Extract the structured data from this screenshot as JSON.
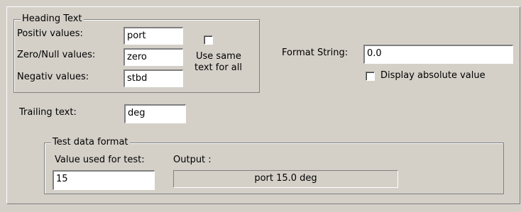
{
  "heading_group": {
    "legend": "Heading Text",
    "positive_label": "Positiv values:",
    "positive_value": "port",
    "zero_label": "Zero/Null values:",
    "zero_value": "zero",
    "negative_label": "Negativ values:",
    "negative_value": "stbd",
    "same_text_checked": false,
    "same_text_label_line1": "Use same",
    "same_text_label_line2": "text for all"
  },
  "format": {
    "label": "Format String:",
    "value": "0.0",
    "absolute_checked": false,
    "absolute_label": "Display absolute value"
  },
  "trailing": {
    "label": "Trailing text:",
    "value": "deg"
  },
  "test_group": {
    "legend": "Test data format",
    "value_label": "Value used for test:",
    "value": "15",
    "output_label": "Output :",
    "output_value": "port 15.0 deg"
  }
}
